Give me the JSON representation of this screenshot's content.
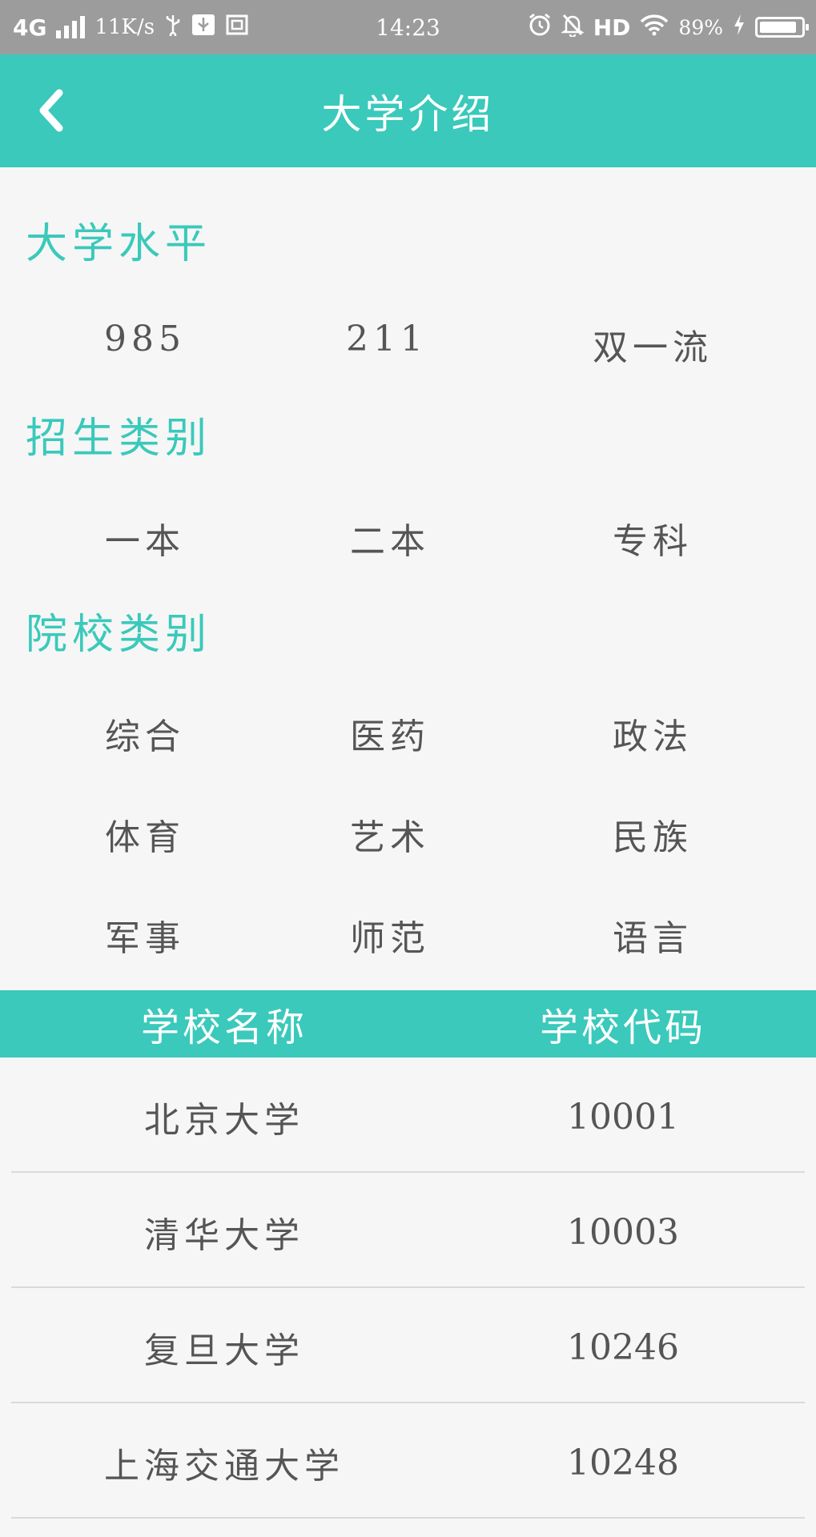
{
  "status_bar": {
    "network": "4G",
    "speed": "11K/s",
    "time": "14:23",
    "hd": "HD",
    "battery_percent": "89%",
    "battery_level": 0.89
  },
  "header": {
    "title": "大学介绍",
    "background": "#3ac9bb"
  },
  "sections": [
    {
      "title": "大学水平",
      "options": [
        "985",
        "211",
        "双一流"
      ]
    },
    {
      "title": "招生类别",
      "options": [
        "一本",
        "二本",
        "专科"
      ]
    },
    {
      "title": "院校类别",
      "options": [
        "综合",
        "医药",
        "政法",
        "体育",
        "艺术",
        "民族",
        "军事",
        "师范",
        "语言"
      ]
    }
  ],
  "table": {
    "headers": [
      "学校名称",
      "学校代码"
    ],
    "rows": [
      {
        "name": "北京大学",
        "code": "10001"
      },
      {
        "name": "清华大学",
        "code": "10003"
      },
      {
        "name": "复旦大学",
        "code": "10246"
      },
      {
        "name": "上海交通大学",
        "code": "10248"
      }
    ]
  },
  "colors": {
    "accent": "#3ac9bb",
    "text": "#555555",
    "status_bar": "#9c9c9c"
  },
  "icons": [
    "back-arrow-icon",
    "usb-icon",
    "alarm-icon",
    "notifications-off-icon",
    "wifi-icon",
    "charging-icon"
  ]
}
